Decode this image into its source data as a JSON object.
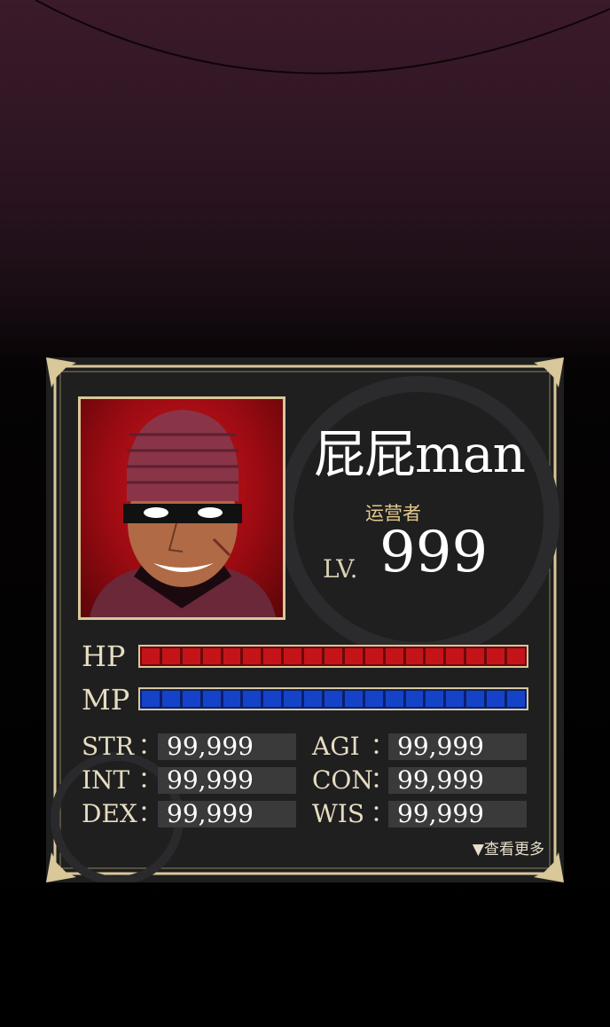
{
  "character": {
    "name": "屁屁man",
    "role": "运营者",
    "level_label": "LV.",
    "level": "999"
  },
  "bars": {
    "hp_label": "HP",
    "mp_label": "MP",
    "hp_fill": 1.0,
    "mp_fill": 1.0
  },
  "stats": {
    "str_label": "STR",
    "str_value": "99,999",
    "agi_label": "AGI",
    "agi_value": "99,999",
    "int_label": "INT",
    "int_value": "99,999",
    "con_label": "CON",
    "con_value": "99,999",
    "dex_label": "DEX",
    "dex_value": "99,999",
    "wis_label": "WIS",
    "wis_value": "99,999",
    "colon": "："
  },
  "more_link": "▼查看更多",
  "colors": {
    "hp": "#c4141a",
    "mp": "#1543c8",
    "frame": "#d8c89a",
    "role_text": "#e2c98b"
  }
}
